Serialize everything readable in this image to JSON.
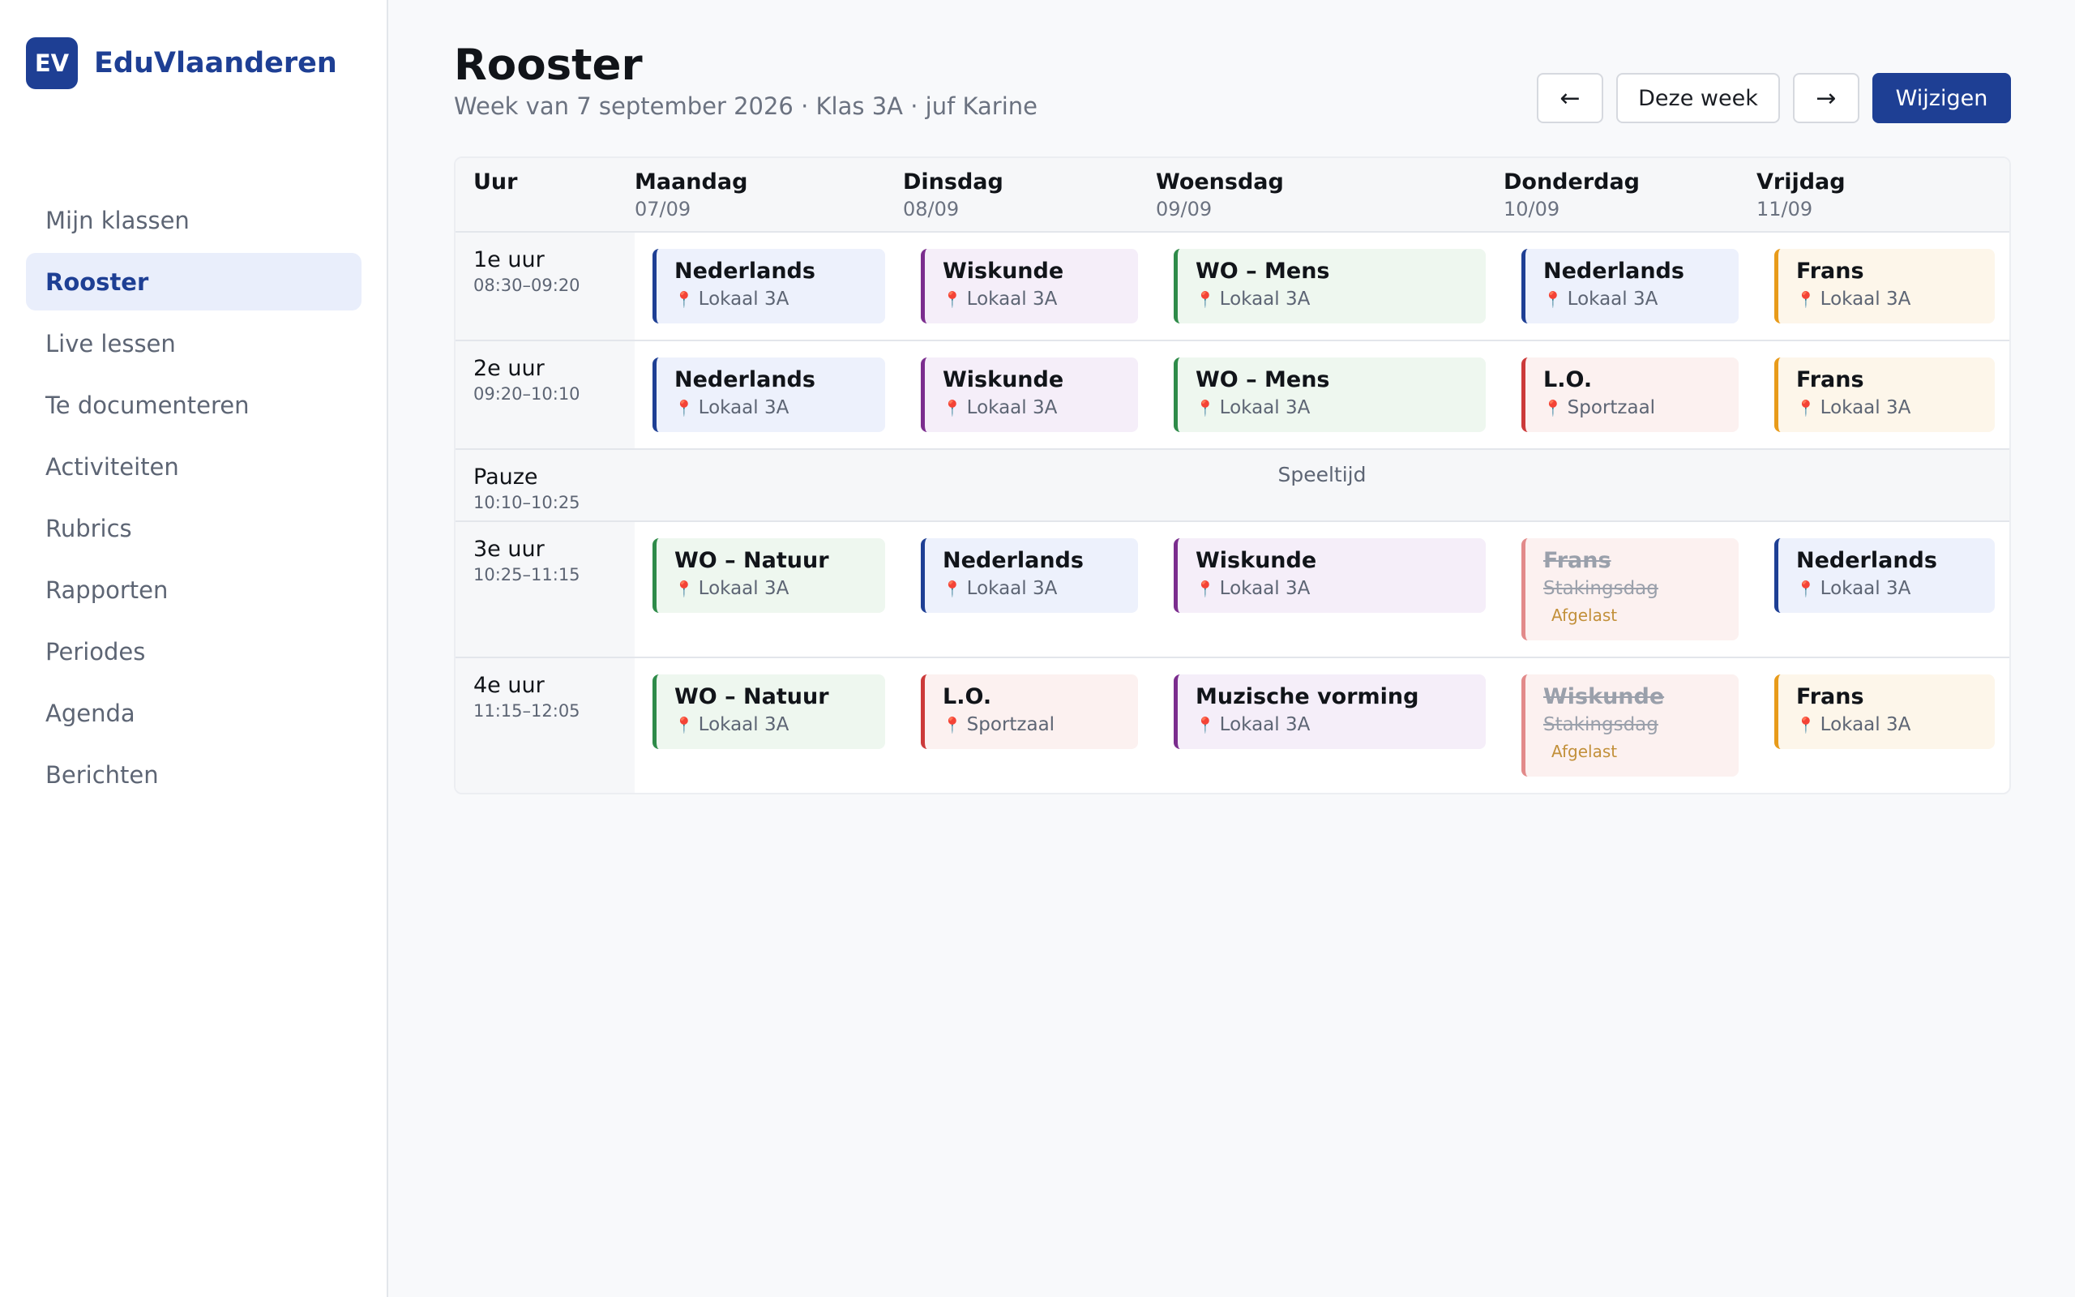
{
  "brand": {
    "logo": "EV",
    "name": "EduVlaanderen"
  },
  "sidebar": {
    "items": [
      {
        "label": "Mijn klassen",
        "active": false
      },
      {
        "label": "Rooster",
        "active": true
      },
      {
        "label": "Live lessen",
        "active": false
      },
      {
        "label": "Te documenteren",
        "active": false
      },
      {
        "label": "Activiteiten",
        "active": false
      },
      {
        "label": "Rubrics",
        "active": false
      },
      {
        "label": "Rapporten",
        "active": false
      },
      {
        "label": "Periodes",
        "active": false
      },
      {
        "label": "Agenda",
        "active": false
      },
      {
        "label": "Berichten",
        "active": false
      }
    ]
  },
  "header": {
    "title": "Rooster",
    "subtitle": "Week van 7 september 2026 · Klas 3A · juf Karine"
  },
  "toolbar": {
    "prev": "←",
    "this_week": "Deze week",
    "next": "→",
    "edit": "Wijzigen"
  },
  "schedule": {
    "hour_header": "Uur",
    "days": [
      {
        "name": "Maandag",
        "date": "07/09"
      },
      {
        "name": "Dinsdag",
        "date": "08/09"
      },
      {
        "name": "Woensdag",
        "date": "09/09"
      },
      {
        "name": "Donderdag",
        "date": "10/09"
      },
      {
        "name": "Vrijdag",
        "date": "11/09"
      }
    ],
    "rows": [
      {
        "name": "1e uur",
        "time": "08:30–09:20",
        "lessons": [
          {
            "subject": "Nederlands",
            "room": "Lokaal 3A"
          },
          {
            "subject": "Wiskunde",
            "room": "Lokaal 3A"
          },
          {
            "subject": "WO – Mens",
            "room": "Lokaal 3A"
          },
          {
            "subject": "Nederlands",
            "room": "Lokaal 3A"
          },
          {
            "subject": "Frans",
            "room": "Lokaal 3A"
          }
        ]
      },
      {
        "name": "2e uur",
        "time": "09:20–10:10",
        "lessons": [
          {
            "subject": "Nederlands",
            "room": "Lokaal 3A"
          },
          {
            "subject": "Wiskunde",
            "room": "Lokaal 3A"
          },
          {
            "subject": "WO – Mens",
            "room": "Lokaal 3A"
          },
          {
            "subject": "L.O.",
            "room": "Sportzaal"
          },
          {
            "subject": "Frans",
            "room": "Lokaal 3A"
          }
        ]
      },
      {
        "name": "Pauze",
        "time": "10:10–10:25",
        "label": "Speeltijd"
      },
      {
        "name": "3e uur",
        "time": "10:25–11:15",
        "lessons": [
          {
            "subject": "WO – Natuur",
            "room": "Lokaal 3A"
          },
          {
            "subject": "Nederlands",
            "room": "Lokaal 3A"
          },
          {
            "subject": "Wiskunde",
            "room": "Lokaal 3A"
          },
          {
            "subject": "Frans",
            "room": "Stakingsdag",
            "badge": "Afgelast"
          },
          {
            "subject": "Nederlands",
            "room": "Lokaal 3A"
          }
        ]
      },
      {
        "name": "4e uur",
        "time": "11:15–12:05",
        "lessons": [
          {
            "subject": "WO – Natuur",
            "room": "Lokaal 3A"
          },
          {
            "subject": "L.O.",
            "room": "Sportzaal"
          },
          {
            "subject": "Muzische vorming",
            "room": "Lokaal 3A"
          },
          {
            "subject": "Wiskunde",
            "room": "Stakingsdag",
            "badge": "Afgelast"
          },
          {
            "subject": "Frans",
            "room": "Lokaal 3A"
          }
        ]
      }
    ]
  },
  "colors": {
    "brand": "#1e3f94",
    "nederlands": "#1e3f94",
    "wiskunde": "#7b2d8e",
    "wo": "#2e8b49",
    "lo": "#cc3a3a",
    "frans": "#e89b1a",
    "muzische": "#7b2d8e",
    "cancelled_badge": "#c2903a"
  },
  "icons": {
    "location": "pin-icon"
  }
}
